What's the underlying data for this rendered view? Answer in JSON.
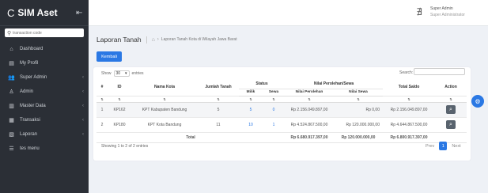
{
  "sidebar": {
    "brand": "SIM Aset",
    "logo_icon": "C",
    "collapse_icon": "⇤",
    "search_placeholder": "transaction code",
    "items": [
      {
        "label": "Dashboard",
        "icon": "home-icon",
        "glyph": "⌂",
        "has_caret": false
      },
      {
        "label": "My Profil",
        "icon": "profile-icon",
        "glyph": "▤",
        "has_caret": false
      },
      {
        "label": "Super Admin",
        "icon": "users-icon",
        "glyph": "👥",
        "has_caret": true
      },
      {
        "label": "Admin",
        "icon": "user-icon",
        "glyph": "♙",
        "has_caret": true
      },
      {
        "label": "Master Data",
        "icon": "database-icon",
        "glyph": "▥",
        "has_caret": true
      },
      {
        "label": "Transaksi",
        "icon": "transaction-icon",
        "glyph": "▦",
        "has_caret": true
      },
      {
        "label": "Laporan",
        "icon": "report-icon",
        "glyph": "▧",
        "has_caret": true
      },
      {
        "label": "tes menu",
        "icon": "menu-icon",
        "glyph": "☰",
        "has_caret": false
      }
    ]
  },
  "topbar": {
    "user_name": "Super Admin",
    "user_role": "Super Administrator"
  },
  "header": {
    "title": "Laporan Tanah",
    "breadcrumb_current": "Laporan Tanah Kota di Wilayah Jawa Barat"
  },
  "toolbar": {
    "back_label": "Kembali"
  },
  "table_controls": {
    "show_label": "Show",
    "show_value": "30",
    "entries_label": "entries",
    "search_label": "Search:"
  },
  "table": {
    "headers": {
      "no": "#",
      "id": "ID",
      "nama_kota": "Nama Kota",
      "jumlah_tanah": "Jumlah Tanah",
      "status": "Status",
      "milik": "Milik",
      "sewa": "Sewa",
      "nilai_group": "Nilai Perolehan/Sewa",
      "nilai_perolehan": "Nilai Perolehan",
      "nilai_sewa": "Nilai Sewa",
      "total_saldo": "Total Saldo",
      "action": "Action"
    },
    "rows": [
      {
        "no": "1",
        "id": "KP162",
        "nama_kota": "KPT Kabupaten Bandung",
        "jumlah": "5",
        "milik": "5",
        "sewa": "0",
        "nilai_perolehan": "Rp 2.156.049.897,00",
        "nilai_sewa": "Rp 0,00",
        "total_saldo": "Rp 2.156.049.897,00"
      },
      {
        "no": "2",
        "id": "KP180",
        "nama_kota": "KPT Kota Bandung",
        "jumlah": "11",
        "milik": "10",
        "sewa": "1",
        "nilai_perolehan": "Rp 4.524.867.500,00",
        "nilai_sewa": "Rp 120.000.000,00",
        "total_saldo": "Rp 4.644.867.500,00"
      }
    ],
    "total": {
      "label": "Total",
      "nilai_perolehan": "Rp 6.680.917.397,00",
      "nilai_sewa": "Rp 120.000.000,00",
      "total_saldo": "Rp 6.800.917.397,00"
    }
  },
  "footer": {
    "entries_info": "Showing 1 to 2 of 2 entries",
    "prev_label": "Prev",
    "current_page": "1",
    "next_label": "Next"
  },
  "colors": {
    "primary": "#2a78e4",
    "sidebar_bg": "#2b2f36"
  }
}
